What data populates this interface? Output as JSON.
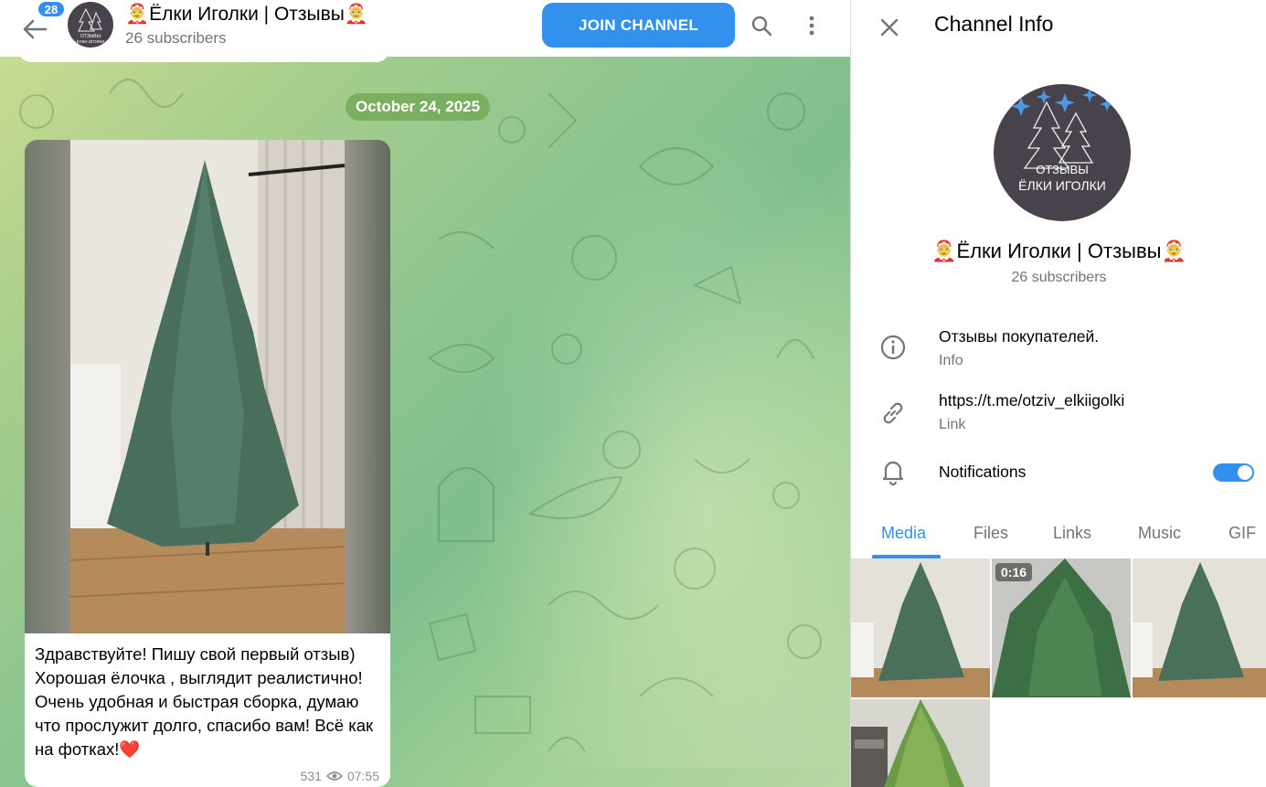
{
  "header": {
    "unread_count": "28",
    "channel_title": "🤶Ёлки Иголки | Отзывы🤶",
    "subscribers": "26 subscribers",
    "join_label": "JOIN CHANNEL",
    "icons": [
      "back-arrow-icon",
      "search-icon",
      "more-vertical-icon"
    ],
    "avatar_text_top": "ОТЗЫВЫ",
    "avatar_text_bottom": "ЁЛКИ ИГОЛКИ"
  },
  "chat": {
    "date": "October 24, 2025",
    "message": {
      "text": "Здравствуйте! Пишу свой первый отзыв) Хорошая ёлочка , выглядит реалистично! Очень удобная и быстрая сборка, думаю что прослужит долго, спасибо вам! Всё как на фотках!❤️",
      "views": "531",
      "time": "07:55"
    }
  },
  "panel": {
    "title": "Channel Info",
    "avatar_text_top": "ОТЗЫВЫ",
    "avatar_text_bottom": "ЁЛКИ ИГОЛКИ",
    "channel_name": "🤶Ёлки Иголки | Отзывы🤶",
    "subscribers": "26 subscribers",
    "info": {
      "value": "Отзывы покупателей.",
      "label": "Info"
    },
    "link": {
      "value": "https://t.me/otziv_elkiigolki",
      "label": "Link"
    },
    "notifications": {
      "label": "Notifications",
      "enabled": true
    },
    "tabs": [
      "Media",
      "Files",
      "Links",
      "Music",
      "GIF"
    ],
    "active_tab": "Media",
    "media": [
      {
        "duration": ""
      },
      {
        "duration": "0:16"
      },
      {
        "duration": ""
      },
      {
        "duration": ""
      }
    ]
  },
  "colors": {
    "accent": "#3390ec",
    "avatar_bg": "#48424d",
    "secondary_text": "#707579"
  }
}
